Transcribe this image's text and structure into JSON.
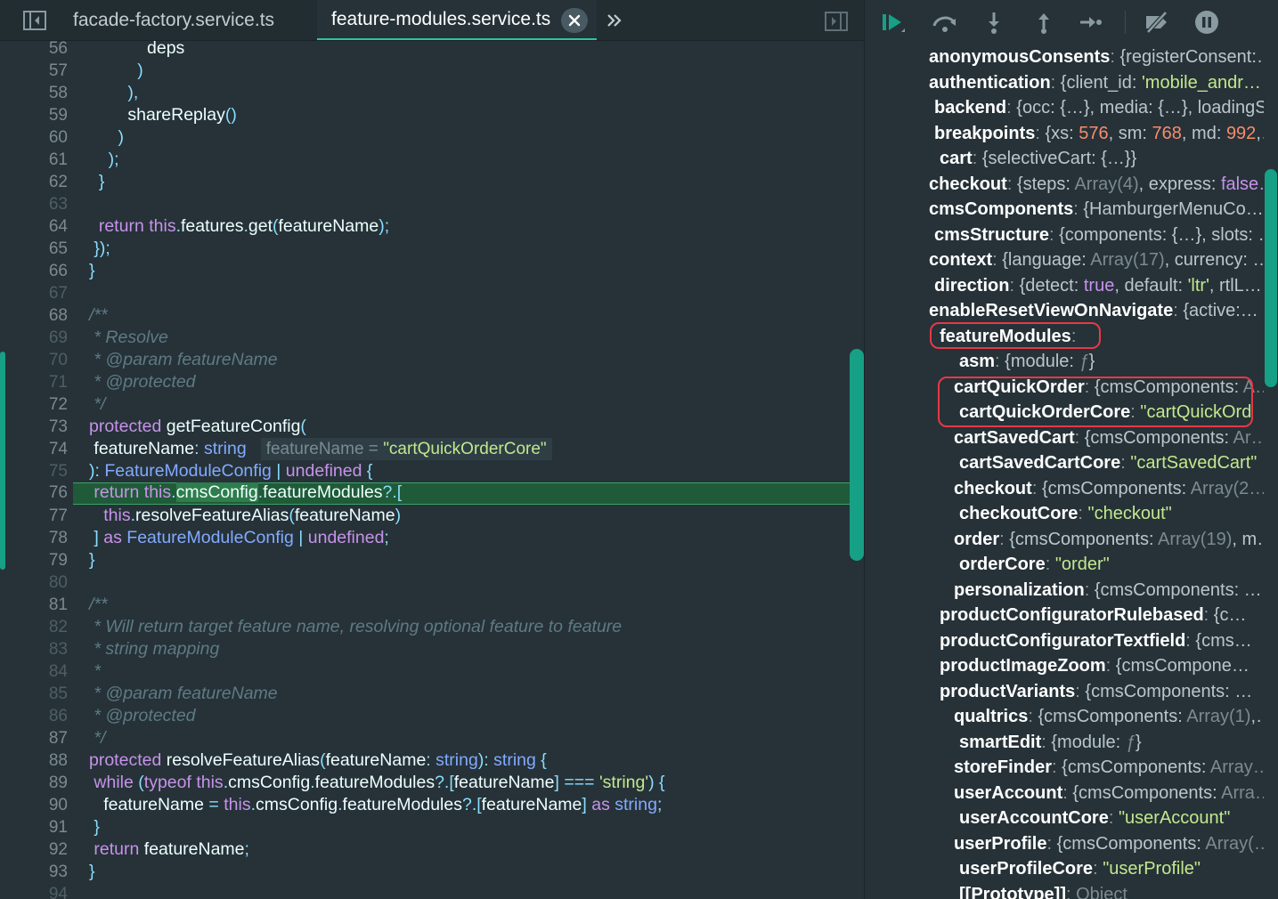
{
  "tabs": {
    "tab1": "facade-factory.service.ts",
    "tab2": "feature-modules.service.ts"
  },
  "icons": {
    "sidebar_toggle": "sidebar-toggle-icon",
    "close": "close-icon",
    "overflow": "chevron-double-right-icon",
    "split": "split-editor-icon",
    "continue": "continue-icon",
    "step_over": "step-over-icon",
    "step_into": "step-into-icon",
    "step_out": "step-out-icon",
    "run_to_cursor": "run-to-cursor-icon",
    "deactivate_breakpoints": "deactivate-breakpoints-icon",
    "pause_on_exceptions": "pause-icon"
  },
  "colors": {
    "accent": "#16a085",
    "current_line": "#1f5b38",
    "annotation_box": "#e53946"
  },
  "editor": {
    "inline_value_label": "featureName = ",
    "inline_value_string": "\"cartQuickOrderCore\"",
    "highlighted_line": 76,
    "lines": [
      {
        "n": "56",
        "html": "            <span class='fn'>deps</span>"
      },
      {
        "n": "57",
        "html": "          <span class='p'>)</span>"
      },
      {
        "n": "58",
        "html": "        <span class='p'>),</span>"
      },
      {
        "n": "59",
        "html": "        <span class='fn'>shareReplay</span><span class='p'>()</span>"
      },
      {
        "n": "60",
        "html": "      <span class='p'>)</span>"
      },
      {
        "n": "61",
        "html": "    <span class='p'>);</span>"
      },
      {
        "n": "62",
        "html": "  <span class='p'>}</span>"
      },
      {
        "n": "63",
        "html": "",
        "dim": true
      },
      {
        "n": "64",
        "html": "  <span class='k'>return</span> <span class='k'>this</span><span class='p'>.</span>features<span class='p'>.</span>get<span class='p'>(</span>featureName<span class='p'>);</span>"
      },
      {
        "n": "65",
        "html": " <span class='p'>});</span>"
      },
      {
        "n": "66",
        "html": "<span class='p'>}</span>"
      },
      {
        "n": "67",
        "html": "",
        "dim": true
      },
      {
        "n": "68",
        "html": "<span class='c'>/**</span>"
      },
      {
        "n": "69",
        "html": "<span class='c'> * Resolve</span>",
        "dim": true
      },
      {
        "n": "70",
        "html": "<span class='c'> * @param featureName</span>",
        "dim": true
      },
      {
        "n": "71",
        "html": "<span class='c'> * @protected</span>",
        "dim": true
      },
      {
        "n": "72",
        "html": "<span class='c'> */</span>"
      },
      {
        "n": "73",
        "html": "<span class='k'>protected</span> getFeatureConfig<span class='p'>(</span>"
      },
      {
        "n": "74",
        "html": " featureName<span class='p'>:</span> <span class='t'>string</span>",
        "hint": true
      },
      {
        "n": "75",
        "html": "<span class='p'>):</span> <span class='t'>FeatureModuleConfig</span> <span class='p'>|</span> <span class='k'>undefined</span> <span class='p'>{</span>",
        "dim": true
      },
      {
        "n": "76",
        "html": " <span class='k'>return</span> <span class='k'>this</span><span class='p'>.</span><span class='sel'>cmsConfig</span><span class='p'>.</span>featureModules<span class='p'>?.[</span>",
        "hl": true
      },
      {
        "n": "77",
        "html": "   <span class='k'>this</span><span class='p'>.</span>resolveFeatureAlias<span class='p'>(</span>featureName<span class='p'>)</span>"
      },
      {
        "n": "78",
        "html": " <span class='p'>]</span> <span class='k'>as</span> <span class='t'>FeatureModuleConfig</span> <span class='p'>|</span> <span class='k'>undefined</span><span class='p'>;</span>"
      },
      {
        "n": "79",
        "html": "<span class='p'>}</span>"
      },
      {
        "n": "80",
        "html": "",
        "dim": true
      },
      {
        "n": "81",
        "html": "<span class='c'>/**</span>"
      },
      {
        "n": "82",
        "html": "<span class='c'> * Will return target feature name, resolving optional feature to feature</span>",
        "dim": true
      },
      {
        "n": "83",
        "html": "<span class='c'> * string mapping</span>",
        "dim": true
      },
      {
        "n": "84",
        "html": "<span class='c'> *</span>",
        "dim": true
      },
      {
        "n": "85",
        "html": "<span class='c'> * @param featureName</span>",
        "dim": true
      },
      {
        "n": "86",
        "html": "<span class='c'> * @protected</span>",
        "dim": true
      },
      {
        "n": "87",
        "html": "<span class='c'> */</span>"
      },
      {
        "n": "88",
        "html": "<span class='k'>protected</span> resolveFeatureAlias<span class='p'>(</span>featureName<span class='p'>:</span> <span class='t'>string</span><span class='p'>):</span> <span class='t'>string</span> <span class='p'>{</span>"
      },
      {
        "n": "89",
        "html": " <span class='k'>while</span> <span class='p'>(</span><span class='k'>typeof</span> <span class='k'>this</span><span class='p'>.</span>cmsConfig<span class='p'>.</span>featureModules<span class='p'>?.[</span>featureName<span class='p'>]</span> <span class='p'>===</span> <span class='s'>'string'</span><span class='p'>)</span> <span class='p'>{</span>"
      },
      {
        "n": "90",
        "html": "   featureName <span class='p'>=</span> <span class='k'>this</span><span class='p'>.</span>cmsConfig<span class='p'>.</span>featureModules<span class='p'>?.[</span>featureName<span class='p'>]</span> <span class='k'>as</span> <span class='t'>string</span><span class='p'>;</span>"
      },
      {
        "n": "91",
        "html": " <span class='p'>}</span>"
      },
      {
        "n": "92",
        "html": " <span class='k'>return</span> featureName<span class='p'>;</span>"
      },
      {
        "n": "93",
        "html": "<span class='p'>}</span>"
      },
      {
        "n": "94",
        "html": "",
        "dim": true
      }
    ]
  },
  "debug_vars": [
    {
      "name": "anonymousConsents",
      "val": "{registerConsent:…",
      "indent": 0
    },
    {
      "name": "authentication",
      "val": "{client_id: <span class='s'>'mobile_andr…</span>",
      "indent": 0
    },
    {
      "name": "backend",
      "val": "{occ: {…}, media: {…}, loadingS…",
      "indent": 1
    },
    {
      "name": "breakpoints",
      "val": "{xs: <span class='n'>576</span>, sm: <span class='n'>768</span>, md: <span class='n'>992</span>,…",
      "indent": 1
    },
    {
      "name": "cart",
      "val": "{selectiveCart: {…}}",
      "indent": 2
    },
    {
      "name": "checkout",
      "val": "{steps: <span class='g'>Array(4)</span>, express: <span class='b'>false…</span>",
      "indent": 0
    },
    {
      "name": "cmsComponents",
      "val": "{HamburgerMenuCo…",
      "indent": 0
    },
    {
      "name": "cmsStructure",
      "val": "{components: {…}, slots: …",
      "indent": 1
    },
    {
      "name": "context",
      "val": "{language: <span class='g'>Array(17)</span>, currency: …",
      "indent": 0
    },
    {
      "name": "direction",
      "val": "{detect: <span class='b'>true</span>, default: <span class='s'>'ltr'</span>, rtlL…",
      "indent": 1
    },
    {
      "name": "enableResetViewOnNavigate",
      "val": "{active:…",
      "indent": 0
    },
    {
      "name": "featureModules",
      "val": "",
      "indent": 3
    },
    {
      "name": "asm",
      "val": "{module: <span class='f'>ƒ</span>}",
      "indent": 5
    },
    {
      "name": "cartQuickOrder",
      "val": "{cmsComponents: <span class='g'>A…</span>",
      "indent": 4
    },
    {
      "name": "cartQuickOrderCore",
      "val": "<span class='s'>\"cartQuickOrd</span>",
      "indent": 5
    },
    {
      "name": "cartSavedCart",
      "val": "{cmsComponents: <span class='g'>Ar…</span>",
      "indent": 4
    },
    {
      "name": "cartSavedCartCore",
      "val": "<span class='s'>\"cartSavedCart\"</span>",
      "indent": 5
    },
    {
      "name": "checkout",
      "val": "{cmsComponents: <span class='g'>Array(2…</span>",
      "indent": 4
    },
    {
      "name": "checkoutCore",
      "val": "<span class='s'>\"checkout\"</span>",
      "indent": 5
    },
    {
      "name": "order",
      "val": "{cmsComponents: <span class='g'>Array(19)</span>, m…",
      "indent": 4
    },
    {
      "name": "orderCore",
      "val": "<span class='s'>\"order\"</span>",
      "indent": 5
    },
    {
      "name": "personalization",
      "val": "{cmsComponents: …",
      "indent": 4
    },
    {
      "name": "productConfiguratorRulebased",
      "val": "{c…",
      "indent": 3
    },
    {
      "name": "productConfiguratorTextfield",
      "val": "{cms…",
      "indent": 3
    },
    {
      "name": "productImageZoom",
      "val": "{cmsCompone…",
      "indent": 3
    },
    {
      "name": "productVariants",
      "val": "{cmsComponents: …",
      "indent": 3
    },
    {
      "name": "qualtrics",
      "val": "{cmsComponents: <span class='g'>Array(1)</span>,…",
      "indent": 4
    },
    {
      "name": "smartEdit",
      "val": "{module: <span class='f'>ƒ</span>}",
      "indent": 5
    },
    {
      "name": "storeFinder",
      "val": "{cmsComponents: <span class='g'>Array…</span>",
      "indent": 4
    },
    {
      "name": "userAccount",
      "val": "{cmsComponents: <span class='g'>Arra…</span>",
      "indent": 4
    },
    {
      "name": "userAccountCore",
      "val": "<span class='s'>\"userAccount\"</span>",
      "indent": 5
    },
    {
      "name": "userProfile",
      "val": "{cmsComponents: <span class='g'>Array(…</span>",
      "indent": 4
    },
    {
      "name": "userProfileCore",
      "val": "<span class='s'>\"userProfile\"</span>",
      "indent": 5
    },
    {
      "name": "[[Prototype]]",
      "val": "<span class='g'>Object</span>",
      "indent": 5
    }
  ]
}
